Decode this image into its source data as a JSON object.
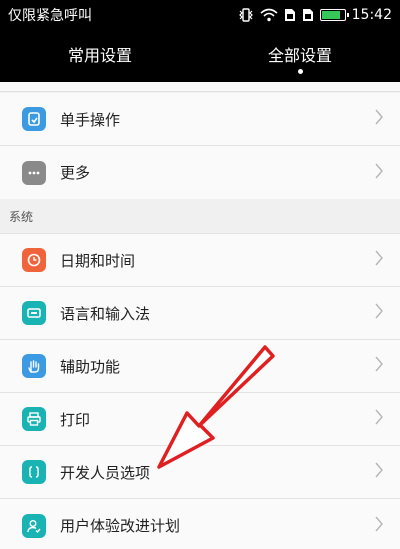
{
  "status_bar": {
    "carrier_text": "仅限紧急呼叫",
    "time": "15:42",
    "battery_level": 0.85
  },
  "tabs": [
    {
      "label": "常用设置",
      "selected": false
    },
    {
      "label": "全部设置",
      "selected": true
    }
  ],
  "list_top": [
    {
      "label": "单手操作",
      "icon": "one-hand-icon",
      "color": "#3b9ae1"
    },
    {
      "label": "更多",
      "icon": "more-icon",
      "color": "#8a8a8a"
    }
  ],
  "section": {
    "title": "系统"
  },
  "list_system": [
    {
      "label": "日期和时间",
      "icon": "clock-icon",
      "color": "#f0643c"
    },
    {
      "label": "语言和输入法",
      "icon": "keyboard-icon",
      "color": "#19b3b3"
    },
    {
      "label": "辅助功能",
      "icon": "hand-icon",
      "color": "#3b9ae1"
    },
    {
      "label": "打印",
      "icon": "printer-icon",
      "color": "#19b3b3"
    },
    {
      "label": "开发人员选项",
      "icon": "code-brackets-icon",
      "color": "#19b3b3"
    },
    {
      "label": "用户体验改进计划",
      "icon": "user-plan-icon",
      "color": "#19b3b3"
    }
  ],
  "annotation": {
    "arrow_color": "#e02020"
  }
}
